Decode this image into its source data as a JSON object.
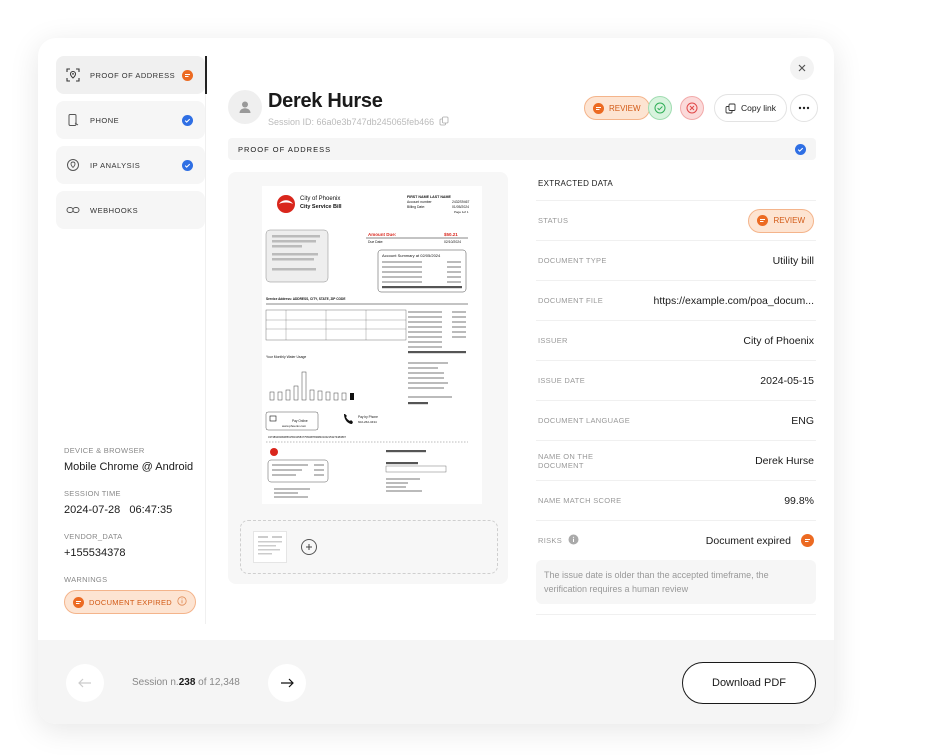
{
  "sidebar": {
    "items": [
      {
        "label": "PROOF OF ADDRESS",
        "status": "review"
      },
      {
        "label": "PHONE",
        "status": "verified"
      },
      {
        "label": "IP ANALYSIS",
        "status": "verified"
      },
      {
        "label": "WEBHOOKS",
        "status": "none"
      }
    ],
    "meta": {
      "device_label": "DEVICE & BROWSER",
      "device_value": "Mobile Chrome @ Android",
      "session_time_label": "SESSION TIME",
      "session_time_value": "2024-07-28   06:47:35",
      "vendor_label": "VENDOR_DATA",
      "vendor_value": "+155534378",
      "warnings_label": "WARNINGS",
      "warning_badge": "DOCUMENT EXPIRED"
    }
  },
  "header": {
    "name": "Derek Hurse",
    "session_id": "Session ID: 66a0e3b747db245065feb466",
    "review_label": "REVIEW",
    "copy_link_label": "Copy link"
  },
  "section": {
    "title": "PROOF OF ADDRESS"
  },
  "document": {
    "city": "City of Phoenix",
    "bill_title": "City Service Bill",
    "name_line": "FIRST NAME LAST NAME",
    "account_number_label": "Account number",
    "account_number": "2432S9467",
    "billing_date_label": "Billing Date:",
    "billing_date": "01/05/2024",
    "page_label": "Page 1of 1",
    "amount_due_label": "Amount Due:",
    "amount_due": "$50.21",
    "due_date_label": "Due Date:",
    "due_date": "02/10/2024",
    "summary_title": "Account Summary at 02/05/2024",
    "service_address": "Service Address: ADDRESS, CITY, STATE, ZIP CODE",
    "usage_title": "Your Monthly Water Usage",
    "pay_online": "Pay Online",
    "pay_online_url": "www.phoenix.com",
    "pay_phone": "Pay by Phone",
    "pay_phone_number": "602-262-3434",
    "barcode_text": "437389493993856155193584775690878398401002153273483897"
  },
  "extracted": {
    "title": "EXTRACTED DATA",
    "status_label": "STATUS",
    "status_value": "REVIEW",
    "rows": [
      {
        "label": "DOCUMENT TYPE",
        "value": "Utility bill"
      },
      {
        "label": "DOCUMENT FILE",
        "value": "https://example.com/poa_docum..."
      },
      {
        "label": "ISSUER",
        "value": "City of Phoenix"
      },
      {
        "label": "ISSUE DATE",
        "value": "2024-05-15"
      },
      {
        "label": "DOCUMENT LANGUAGE",
        "value": "ENG"
      },
      {
        "label": "NAME ON THE DOCUMENT",
        "value": "Derek Hurse"
      },
      {
        "label": "NAME MATCH SCORE",
        "value": "99.8%"
      }
    ],
    "risks_label": "RISKS",
    "risks_value": "Document expired",
    "risk_note": "The issue date is older than the accepted timeframe, the verification requires a human review"
  },
  "footer": {
    "session_prefix": "Session n.",
    "session_number": "238",
    "session_of": " of 12,348",
    "download_label": "Download PDF"
  },
  "colors": {
    "accent_orange": "#ec6a22",
    "accent_blue": "#2f6fe4",
    "ok_green": "#2fae57",
    "reject_red": "#e04848"
  }
}
